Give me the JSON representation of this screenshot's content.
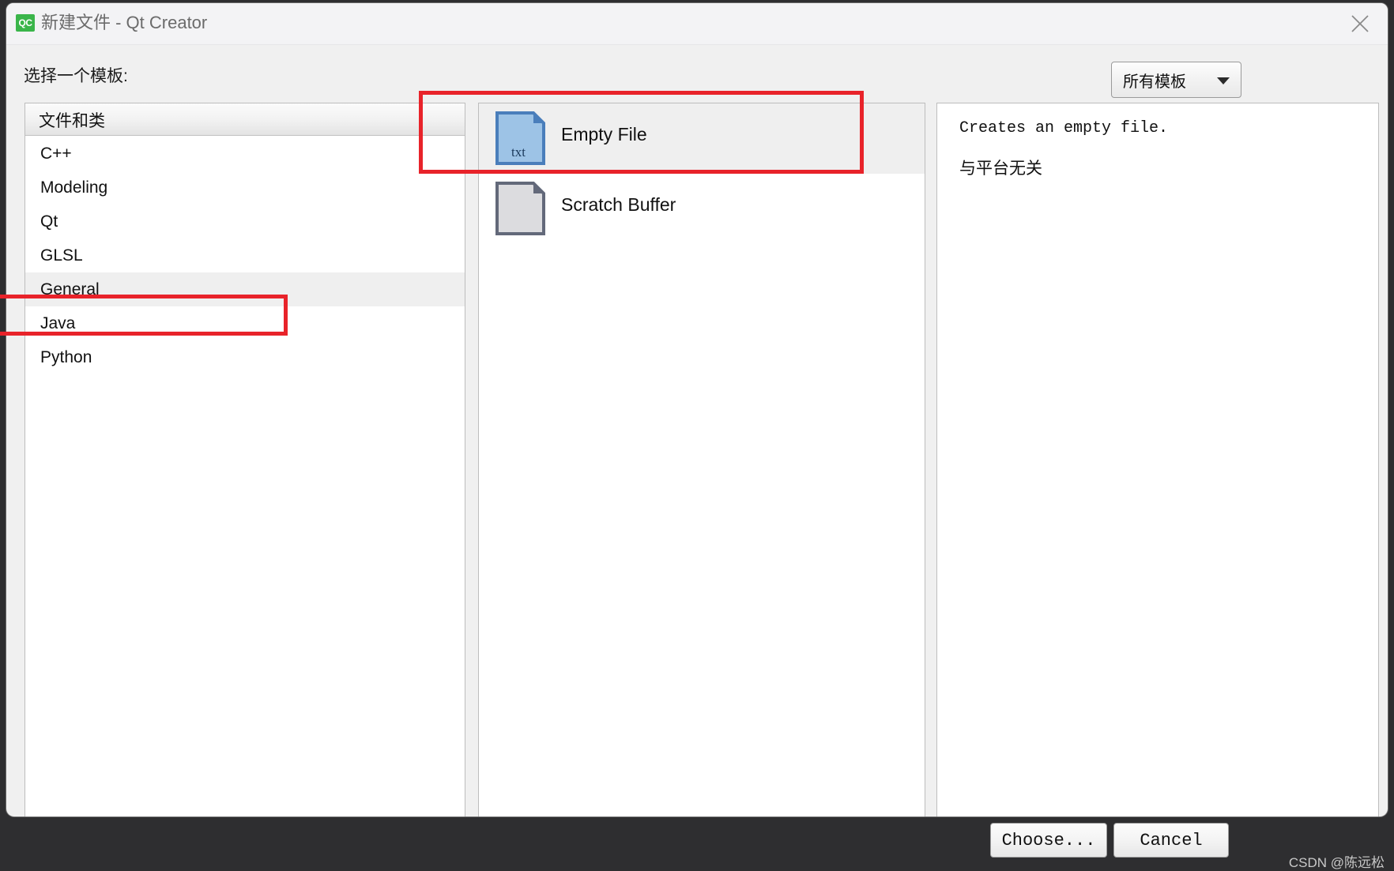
{
  "window": {
    "title": "新建文件 - Qt Creator",
    "app_icon": "QC",
    "close_icon": "close-icon"
  },
  "header": {
    "prompt": "选择一个模板:",
    "filter": {
      "selected": "所有模板",
      "arrow_icon": "chevron-down-icon"
    }
  },
  "categories": {
    "header": "文件和类",
    "items": [
      {
        "label": "C++",
        "selected": false
      },
      {
        "label": "Modeling",
        "selected": false
      },
      {
        "label": "Qt",
        "selected": false
      },
      {
        "label": "GLSL",
        "selected": false
      },
      {
        "label": "General",
        "selected": true
      },
      {
        "label": "Java",
        "selected": false
      },
      {
        "label": "Python",
        "selected": false
      }
    ]
  },
  "templates": {
    "items": [
      {
        "label": "Empty File",
        "icon": "text-file-icon",
        "ext": "txt",
        "selected": true
      },
      {
        "label": "Scratch Buffer",
        "icon": "blank-file-icon",
        "ext": "",
        "selected": false
      }
    ]
  },
  "description": {
    "line1": "Creates an empty file.",
    "line2": "与平台无关"
  },
  "footer": {
    "choose_label": "Choose...",
    "cancel_label": "Cancel"
  },
  "watermark": "CSDN @陈远松",
  "colors": {
    "annotation": "#e8232a",
    "app_icon_bg": "#3ab54a",
    "selection_bg": "#efefef",
    "file_icon_blue": "#9dc3e6",
    "file_icon_blue_border": "#4a7ebb",
    "file_icon_gray": "#dcdcdf",
    "file_icon_gray_border": "#63697a"
  }
}
